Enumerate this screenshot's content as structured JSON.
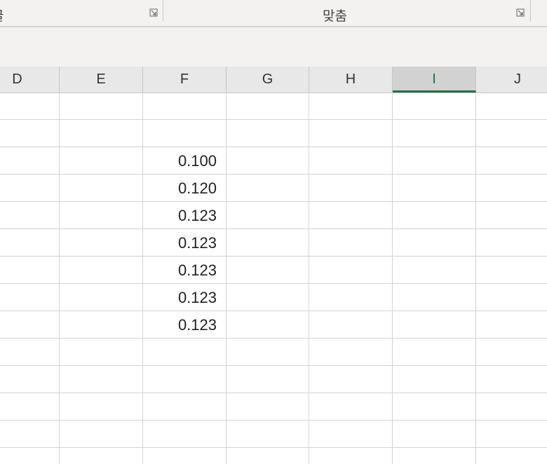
{
  "ribbon": {
    "groups": [
      {
        "label": "글"
      },
      {
        "label": "맞춤"
      }
    ],
    "launcher_icon": "dialog-launcher-icon"
  },
  "sheet": {
    "columns": [
      "D",
      "E",
      "F",
      "G",
      "H",
      "I",
      "J"
    ],
    "selected_column": "I",
    "column_f_values": [
      "",
      "",
      "0.100",
      "0.120",
      "0.123",
      "0.123",
      "0.123",
      "0.123",
      "0.123",
      "",
      "",
      "",
      "",
      ""
    ]
  },
  "colors": {
    "ribbon_bg": "#f3f2f1",
    "header_bg": "#e8e8e8",
    "selected_accent": "#217346",
    "gridline": "#d4d4d4"
  }
}
